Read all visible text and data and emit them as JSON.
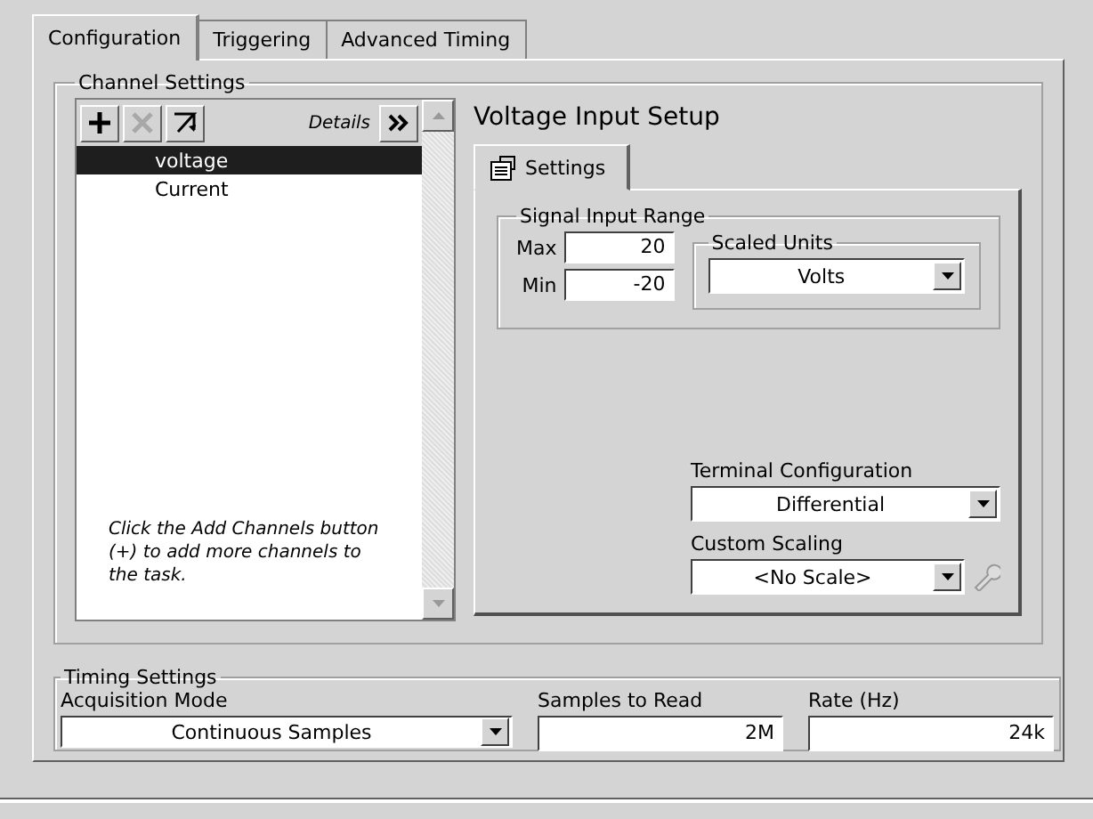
{
  "tabs": [
    {
      "label": "Configuration",
      "selected": true
    },
    {
      "label": "Triggering",
      "selected": false
    },
    {
      "label": "Advanced Timing",
      "selected": false
    }
  ],
  "channel_settings": {
    "title": "Channel Settings",
    "toolbar": [
      {
        "kind": "add",
        "disabled": false
      },
      {
        "kind": "remove",
        "disabled": true
      },
      {
        "kind": "rename",
        "disabled": false
      }
    ],
    "details_label": "Details",
    "channels": [
      {
        "name": "voltage",
        "selected": true
      },
      {
        "name": "Current",
        "selected": false
      }
    ],
    "hint": "Click the Add Channels button (+) to add more channels to the task."
  },
  "setup": {
    "title": "Voltage Input Setup",
    "tabs": [
      {
        "label": "Settings",
        "selected": true
      }
    ],
    "signal_input_range": {
      "title": "Signal Input Range",
      "max": {
        "label": "Max",
        "value": "20"
      },
      "min": {
        "label": "Min",
        "value": "-20"
      }
    },
    "scaled_units": {
      "title": "Scaled Units",
      "value": "Volts"
    },
    "terminal_configuration": {
      "label": "Terminal Configuration",
      "value": "Differential"
    },
    "custom_scaling": {
      "label": "Custom Scaling",
      "value": "<No Scale>"
    }
  },
  "timing": {
    "title": "Timing Settings",
    "acquisition_mode": {
      "label": "Acquisition Mode",
      "value": "Continuous Samples"
    },
    "samples_to_read": {
      "label": "Samples to Read",
      "value": "2M"
    },
    "rate": {
      "label": "Rate (Hz)",
      "value": "24k"
    }
  }
}
